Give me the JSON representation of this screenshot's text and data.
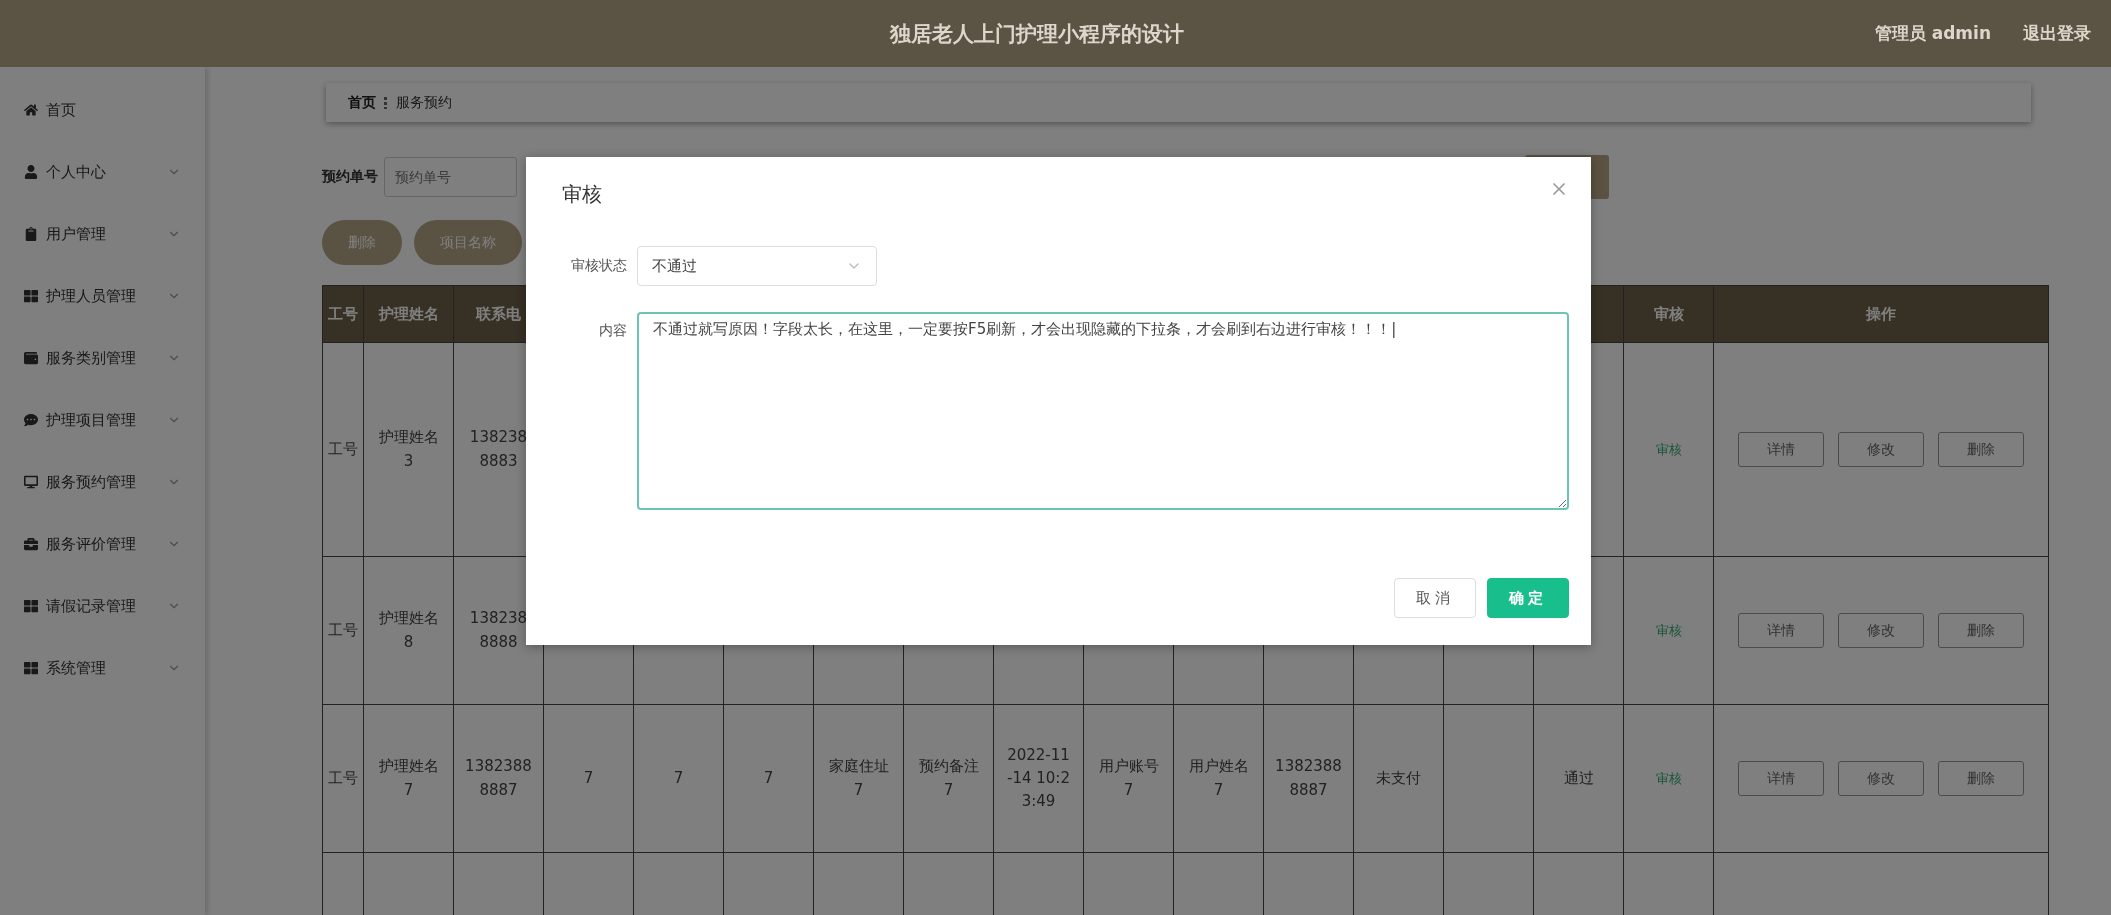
{
  "header": {
    "title": "独居老人上门护理小程序的设计",
    "user": "管理员 admin",
    "logout": "退出登录"
  },
  "sidebar": {
    "items": [
      {
        "label": "首页",
        "kind": "link"
      },
      {
        "label": "个人中心",
        "kind": "menu"
      },
      {
        "label": "用户管理",
        "kind": "menu"
      },
      {
        "label": "护理人员管理",
        "kind": "menu"
      },
      {
        "label": "服务类别管理",
        "kind": "menu"
      },
      {
        "label": "护理项目管理",
        "kind": "menu"
      },
      {
        "label": "服务预约管理",
        "kind": "menu"
      },
      {
        "label": "服务评价管理",
        "kind": "menu"
      },
      {
        "label": "请假记录管理",
        "kind": "menu"
      },
      {
        "label": "系统管理",
        "kind": "menu"
      }
    ]
  },
  "breadcrumb": [
    "首页",
    "服务预约"
  ],
  "search": {
    "label": "预约单号",
    "placeholder": "预约单号"
  },
  "toolbar": [
    "删除",
    "项目名称"
  ],
  "table": {
    "columns": [
      "工号",
      "护理姓名",
      "联系电",
      null,
      null,
      null,
      null,
      null,
      null,
      null,
      null,
      null,
      null,
      null,
      null,
      "审核",
      "操作"
    ],
    "rows": [
      {
        "cells": [
          "工号",
          "护理姓名\n3",
          "138238\n8883",
          null,
          null,
          null,
          null,
          null,
          null,
          null,
          null,
          null,
          null,
          null,
          null
        ],
        "review": "审核",
        "actions": [
          "详情",
          "修改",
          "删除"
        ]
      },
      {
        "cells": [
          "工号",
          "护理姓名\n8",
          "138238\n8888",
          null,
          null,
          null,
          null,
          null,
          null,
          null,
          null,
          null,
          null,
          null,
          null
        ],
        "review": "审核",
        "actions": [
          "详情",
          "修改",
          "删除"
        ]
      },
      {
        "cells": [
          "工号",
          "护理姓名\n7",
          "1382388\n8887",
          "7",
          "7",
          "7",
          "家庭住址\n7",
          "预约备注\n7",
          "2022-11\n-14 10:2\n3:49",
          "用户账号\n7",
          "用户姓名\n7",
          "1382388\n8887",
          "未支付",
          null,
          "通过"
        ],
        "review": "审核",
        "actions": [
          "详情",
          "修改",
          "删除"
        ]
      }
    ]
  },
  "dialog": {
    "title": "审核",
    "status_label": "审核状态",
    "status_value": "不通过",
    "content_label": "内容",
    "content_value": "不通过就写原因！字段太长，在这里，一定要按F5刷新，才会出现隐藏的下拉条，才会刷到右边进行审核！！！|",
    "buttons": [
      {
        "label": "取消",
        "kind": "cancel"
      },
      {
        "label": "确定",
        "kind": "primary"
      }
    ]
  }
}
